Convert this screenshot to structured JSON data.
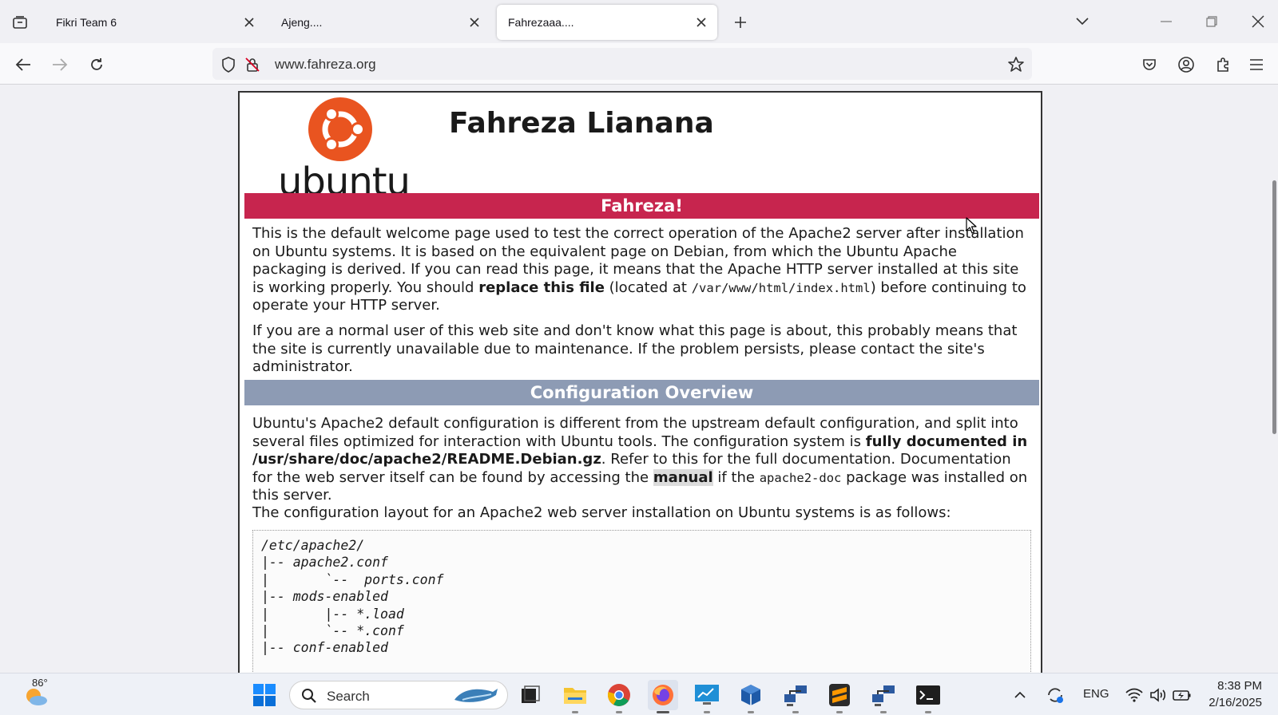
{
  "browser": {
    "tabs": [
      {
        "title": "Fikri Team 6",
        "active": false
      },
      {
        "title": "Ajeng....",
        "active": false
      },
      {
        "title": "Fahrezaaa....",
        "active": true
      }
    ],
    "url": "www.fahreza.org"
  },
  "page": {
    "logo_text": "ubuntu",
    "title": "Fahreza Lianana",
    "banner": "Fahreza!",
    "intro_p1_a": "This is the default welcome page used to test the correct operation of the Apache2 server after installation on Ubuntu systems. It is based on the equivalent page on Debian, from which the Ubuntu Apache packaging is derived. If you can read this page, it means that the Apache HTTP server installed at this site is working properly. You should ",
    "intro_p1_bold": "replace this file",
    "intro_p1_b": " (located at ",
    "intro_p1_code": "/var/www/html/index.html",
    "intro_p1_c": ") before continuing to operate your HTTP server.",
    "intro_p2": "If you are a normal user of this web site and don't know what this page is about, this probably means that the site is currently unavailable due to maintenance. If the problem persists, please contact the site's administrator.",
    "config_heading": "Configuration Overview",
    "config_p1_a": "Ubuntu's Apache2 default configuration is different from the upstream default configuration, and split into several files optimized for interaction with Ubuntu tools. The configuration system is ",
    "config_p1_bold": "fully documented in /usr/share/doc/apache2/README.Debian.gz",
    "config_p1_b": ". Refer to this for the full documentation. Documentation for the web server itself can be found by accessing the ",
    "config_p1_link": "manual",
    "config_p1_c": " if the ",
    "config_p1_code": "apache2-doc",
    "config_p1_d": " package was installed on this server.",
    "config_p2": "The configuration layout for an Apache2 web server installation on Ubuntu systems is as follows:",
    "code_lines": [
      "/etc/apache2/",
      "|-- apache2.conf",
      "|       `--  ports.conf",
      "|-- mods-enabled",
      "|       |-- *.load",
      "|       `-- *.conf",
      "|-- conf-enabled"
    ]
  },
  "taskbar": {
    "weather_temp": "86°",
    "search_label": "Search",
    "language": "ENG",
    "time": "8:38 PM",
    "date": "2/16/2025"
  },
  "colors": {
    "ubuntu_orange": "#e95420",
    "banner_red": "#c7254e",
    "section_grey": "#8d9bb4"
  }
}
